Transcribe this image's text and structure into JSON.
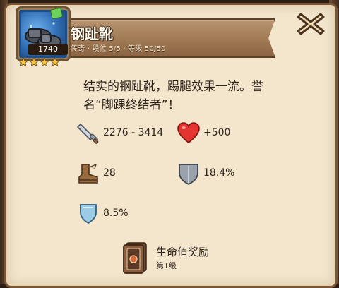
{
  "item": {
    "name": "钢趾靴",
    "subtitle": "传奇 · 段位 5/5 · 等级 50/50",
    "level_badge": "1740"
  },
  "description": "结实的钢趾靴，踢腿效果一流。誉名“脚踝终结者”！",
  "stats": {
    "attack": "2276 - 3414",
    "health": "+500",
    "speed": "28",
    "armor": "18.4%",
    "resistance": "8.5%"
  },
  "reward": {
    "title": "生命值奖励",
    "level": "第1级"
  },
  "icons": {
    "close": "close-x-icon",
    "attack": "sword-icon",
    "health": "heart-icon",
    "speed": "boot-icon",
    "armor": "shield-icon",
    "resistance": "small-shield-icon",
    "reward": "card-icon"
  },
  "colors": {
    "panel": "#f3e6cd",
    "banner": "#a07a55",
    "heart": "#e3342f",
    "item_background": "#2f6db3"
  },
  "rank_stars": 4
}
